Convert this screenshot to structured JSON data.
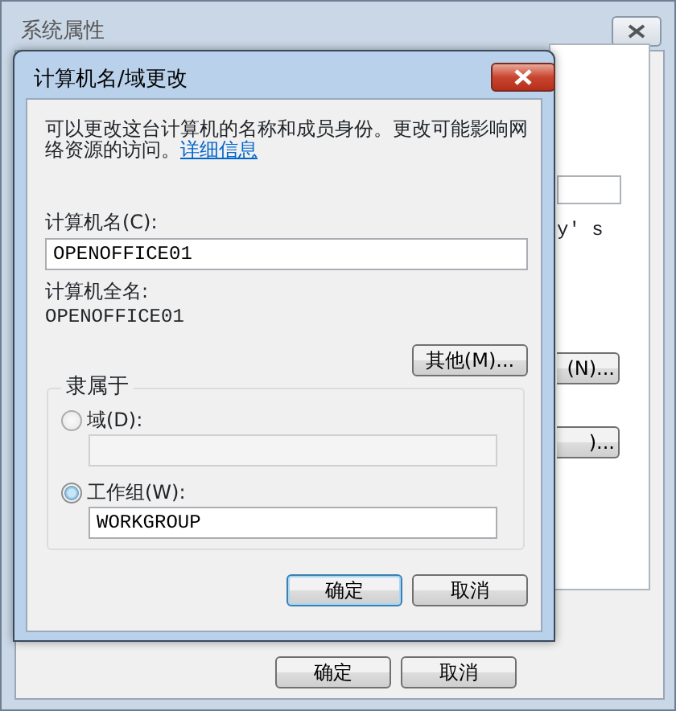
{
  "back_window": {
    "title": "系统属性",
    "text_fragment": "y' s",
    "side_buttons": [
      "(N)...",
      ")..."
    ],
    "buttons": [
      {
        "label": "确定"
      },
      {
        "label": "取消"
      }
    ]
  },
  "dialog": {
    "title": "计算机名/域更改",
    "description": {
      "text": "可以更改这台计算机的名称和成员身份。更改可能影响网络资源的访问。",
      "link": "详细信息"
    },
    "computer_name": {
      "label": "计算机名(C):",
      "value": "OPENOFFICE01"
    },
    "full_name": {
      "label": "计算机全名:",
      "value": "OPENOFFICE01"
    },
    "more_button": "其他(M)...",
    "member_of": {
      "title": "隶属于",
      "options": [
        {
          "label": "域(D):",
          "selected": false
        },
        {
          "label": "工作组(W):",
          "selected": true,
          "value": "WORKGROUP"
        }
      ]
    },
    "buttons": [
      {
        "label": "确定",
        "focused": true
      },
      {
        "label": "取消",
        "focused": false
      }
    ]
  }
}
